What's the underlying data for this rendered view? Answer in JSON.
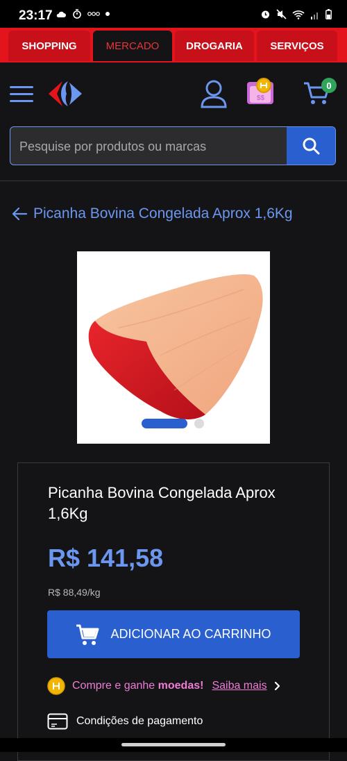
{
  "status_bar": {
    "time": "23:17",
    "left_icons": [
      "cloud-icon",
      "timer-icon",
      "ooo-icon",
      "dot-icon"
    ],
    "right_icons": [
      "alarm-icon",
      "mute-icon",
      "wifi-icon",
      "signal-icon",
      "battery-icon"
    ]
  },
  "tabs": [
    {
      "label": "SHOPPING",
      "active": false
    },
    {
      "label": "MERCADO",
      "active": true
    },
    {
      "label": "DROGARIA",
      "active": false
    },
    {
      "label": "SERVIÇOS",
      "active": false
    }
  ],
  "header": {
    "cart_count": "0",
    "search_placeholder": "Pesquise por produtos ou marcas"
  },
  "breadcrumb": {
    "back_label": "Picanha Bovina Congelada Aprox 1,6Kg"
  },
  "product": {
    "title": "Picanha Bovina Congelada Aprox 1,6Kg",
    "price": "R$ 141,58",
    "unit_price": "R$ 88,49/kg",
    "add_to_cart_label": "ADICIONAR AO CARRINHO",
    "coins_text": "Compre e ganhe ",
    "coins_bold": "moedas!",
    "coins_link": "Saiba mais",
    "payment_label": "Condições de pagamento",
    "carousel_pages": 2,
    "carousel_active": 1
  },
  "colors": {
    "accent": "#2a5fd0",
    "link": "#6c97f0",
    "brand_red": "#e3141b",
    "coins_pink": "#ec7ed4",
    "badge_green": "#2fa45a"
  }
}
